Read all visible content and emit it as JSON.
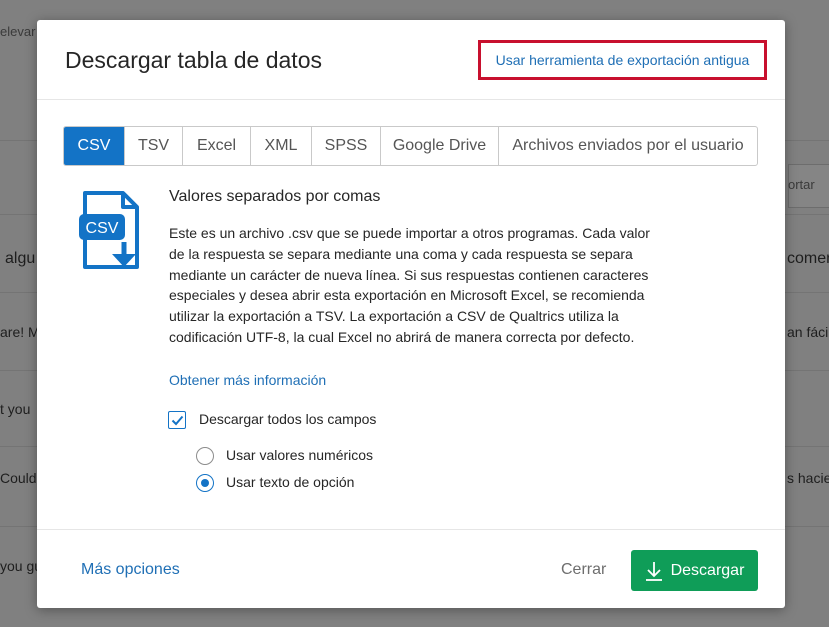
{
  "background": {
    "frag_top_left": "elevar",
    "frag_right_box": "ortar",
    "frag_row1_left": "algu",
    "frag_row1_right": "comer",
    "frag_row2_left": "are! M",
    "frag_row2_right": "an fácil",
    "frag_row3_left": "t you",
    "frag_row4_left": "Could",
    "frag_row4_right": "s hacie",
    "frag_row5_left": "you gu"
  },
  "modal": {
    "title": "Descargar tabla de datos",
    "legacy_link": "Usar herramienta de exportación antigua",
    "tabs": [
      {
        "label": "CSV",
        "active": true
      },
      {
        "label": "TSV",
        "active": false
      },
      {
        "label": "Excel",
        "active": false
      },
      {
        "label": "XML",
        "active": false
      },
      {
        "label": "SPSS",
        "active": false
      },
      {
        "label": "Google Drive",
        "active": false
      },
      {
        "label": "Archivos enviados por el usuario",
        "active": false
      }
    ],
    "icon_text": "CSV",
    "format_title": "Valores separados por comas",
    "format_description": "Este es un archivo .csv que se puede importar a otros programas. Cada valor de la respuesta se separa mediante una coma y cada respuesta se separa mediante un carácter de nueva línea. Si sus respuestas contienen caracteres especiales y desea abrir esta exportación en Microsoft Excel, se recomienda utilizar la exportación a TSV. La exportación a CSV de Qualtrics utiliza la codificación UTF-8, la cual Excel no abrirá de manera correcta por defecto.",
    "learn_more": "Obtener más información",
    "download_all_fields": {
      "label": "Descargar todos los campos",
      "checked": true
    },
    "options": [
      {
        "label": "Usar valores numéricos",
        "checked": false
      },
      {
        "label": "Usar texto de opción",
        "checked": true
      }
    ],
    "footer": {
      "more_options": "Más opciones",
      "close": "Cerrar",
      "download": "Descargar"
    }
  },
  "colors": {
    "accent_blue": "#1373c6",
    "link_blue": "#1f6fb5",
    "download_green": "#0f9d58",
    "highlight_red": "#c8102e",
    "overlay": "#808080"
  }
}
